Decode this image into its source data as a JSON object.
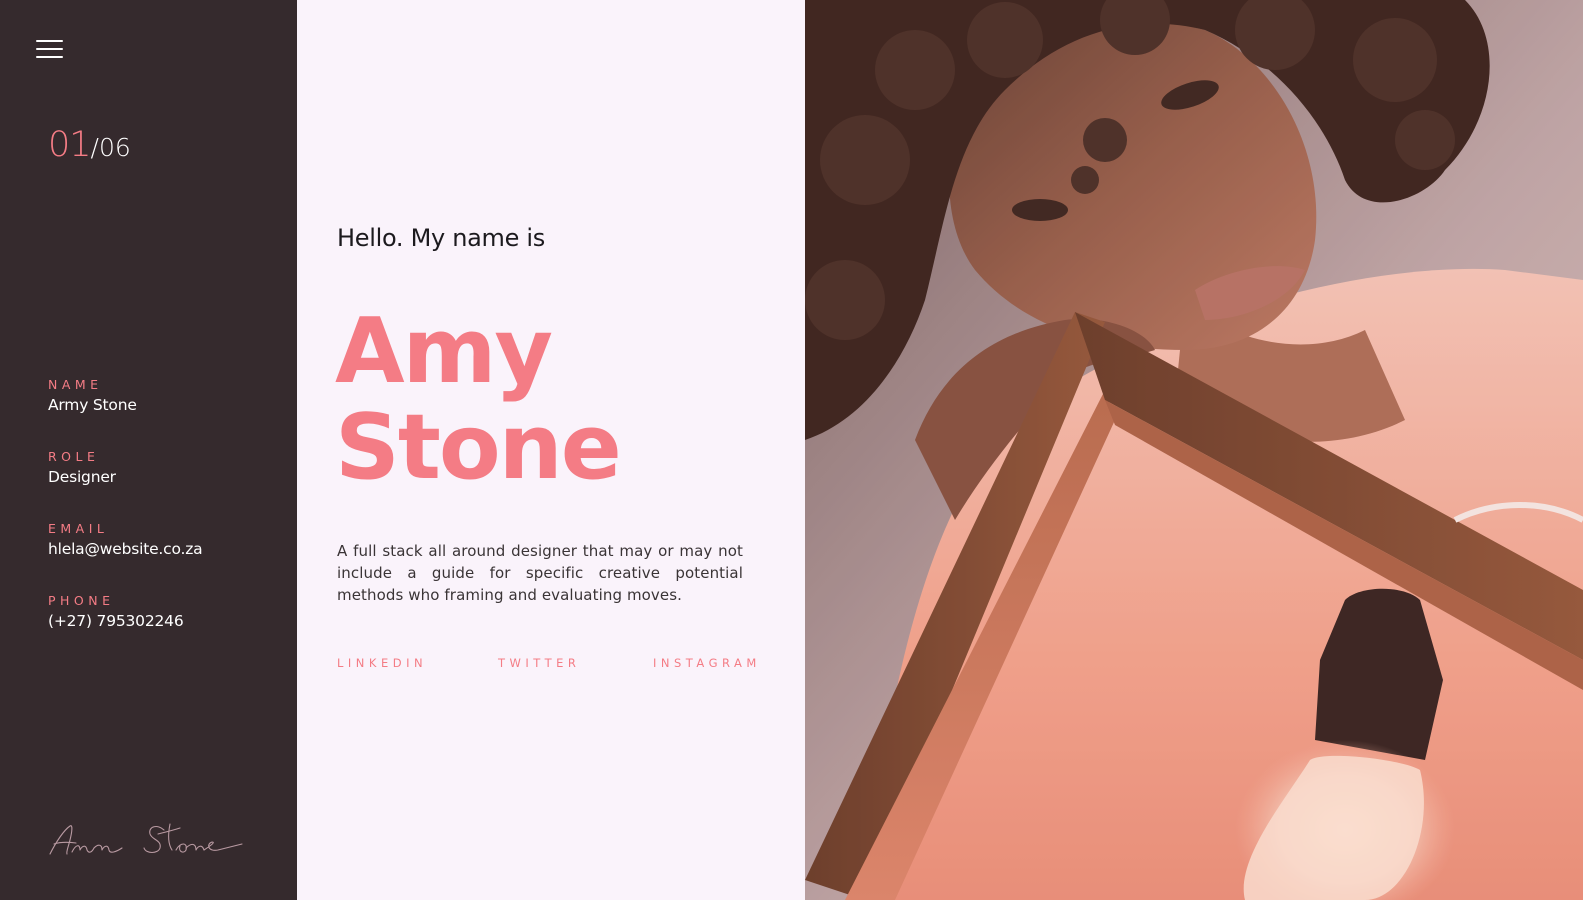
{
  "counter": {
    "current": "01",
    "separator": "/",
    "total": "06"
  },
  "sidebar": {
    "fields": [
      {
        "label": "NAME",
        "value": "Army Stone"
      },
      {
        "label": "ROLE",
        "value": "Designer"
      },
      {
        "label": "EMAIL",
        "value": "hlela@website.co.za"
      },
      {
        "label": "PHONE",
        "value": "(+27) 795302246"
      }
    ]
  },
  "hero": {
    "greeting": "Hello. My name is",
    "first_name": "Amy",
    "last_name": "Stone",
    "bio": "A full stack all around designer that may or may not include a guide for specific creative potential methods who framing and evaluating moves."
  },
  "social": {
    "links": [
      "LINKEDIN",
      "TWITTER",
      "INSTAGRAM"
    ]
  },
  "colors": {
    "accent": "#f47c85",
    "sidebar_bg": "#352a2d",
    "content_bg": "#faf3fb"
  },
  "icons": {
    "menu": "hamburger-menu-icon"
  }
}
